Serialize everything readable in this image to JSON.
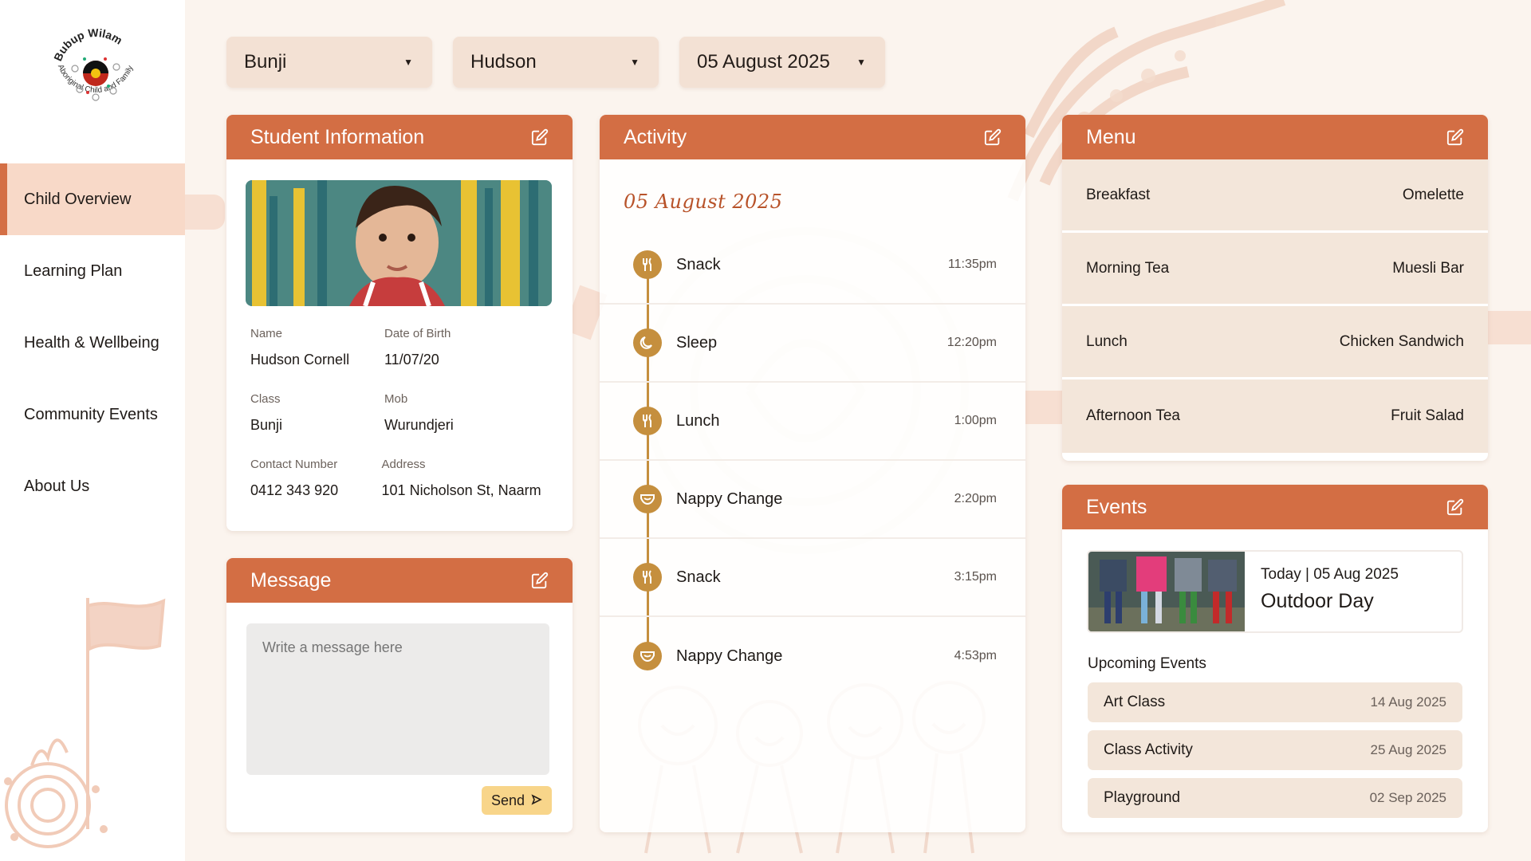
{
  "logo": {
    "top_text": "Bubup Wilam",
    "side_text": "Aboriginal Child and Family Centre"
  },
  "sidebar": {
    "items": [
      {
        "label": "Child Overview",
        "active": true
      },
      {
        "label": "Learning Plan"
      },
      {
        "label": "Health & Wellbeing"
      },
      {
        "label": "Community Events"
      },
      {
        "label": "About Us"
      }
    ]
  },
  "filters": {
    "class": "Bunji",
    "child": "Hudson",
    "date": "05 August 2025"
  },
  "student": {
    "title": "Student Information",
    "name_label": "Name",
    "name": "Hudson Cornell",
    "dob_label": "Date of Birth",
    "dob": "11/07/20",
    "class_label": "Class",
    "class": "Bunji",
    "mob_label": "Mob",
    "mob": "Wurundjeri",
    "contact_label": "Contact Number",
    "contact": "0412 343 920",
    "address_label": "Address",
    "address": "101 Nicholson St, Naarm"
  },
  "message": {
    "title": "Message",
    "placeholder": "Write a message here",
    "send_label": "Send"
  },
  "activity": {
    "title": "Activity",
    "date": "05 August 2025",
    "items": [
      {
        "icon": "cutlery-icon",
        "label": "Snack",
        "time": "11:35pm"
      },
      {
        "icon": "moon-icon",
        "label": "Sleep",
        "time": "12:20pm"
      },
      {
        "icon": "cutlery-icon",
        "label": "Lunch",
        "time": "1:00pm"
      },
      {
        "icon": "nappy-icon",
        "label": "Nappy Change",
        "time": "2:20pm"
      },
      {
        "icon": "cutlery-icon",
        "label": "Snack",
        "time": "3:15pm"
      },
      {
        "icon": "nappy-icon",
        "label": "Nappy Change",
        "time": "4:53pm"
      }
    ]
  },
  "menu": {
    "title": "Menu",
    "items": [
      {
        "meal": "Breakfast",
        "food": "Omelette"
      },
      {
        "meal": "Morning Tea",
        "food": "Muesli Bar"
      },
      {
        "meal": "Lunch",
        "food": "Chicken Sandwich"
      },
      {
        "meal": "Afternoon Tea",
        "food": "Fruit Salad"
      }
    ]
  },
  "events": {
    "title": "Events",
    "today_date": "Today | 05 Aug 2025",
    "today_title": "Outdoor Day",
    "upcoming_title": "Upcoming Events",
    "upcoming": [
      {
        "name": "Art Class",
        "date": "14 Aug 2025"
      },
      {
        "name": "Class Activity",
        "date": "25 Aug 2025"
      },
      {
        "name": "Playground",
        "date": "02 Sep 2025"
      }
    ]
  },
  "colors": {
    "accent": "#d36e44",
    "timeline": "#c58f3e",
    "panel": "#f3e6da",
    "background": "#fbf4ee"
  }
}
